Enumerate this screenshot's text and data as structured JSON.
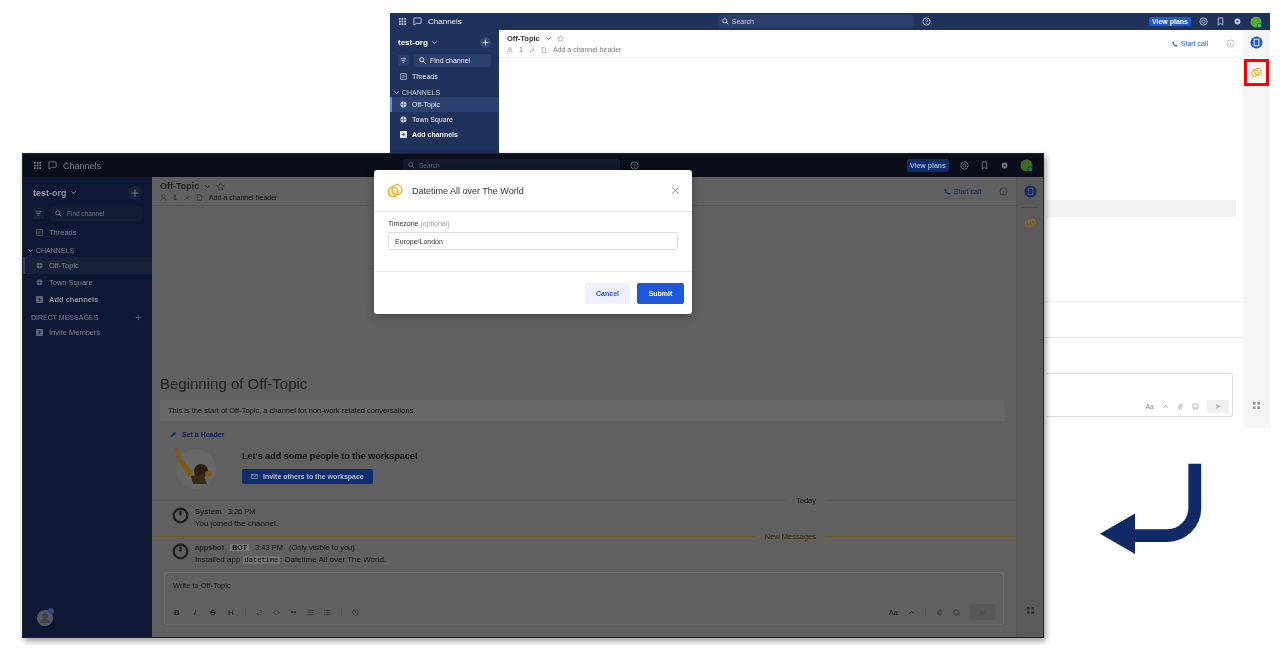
{
  "back_window": {
    "top_bar": {
      "title": "Channels",
      "search_placeholder": "Search",
      "view_plans": "View plans"
    },
    "sidebar": {
      "team": "test-org",
      "find_channel": "Find channel",
      "threads": "Threads",
      "section": "CHANNELS",
      "channels": [
        {
          "name": "Off-Topic",
          "selected": true
        },
        {
          "name": "Town Square",
          "selected": false
        }
      ],
      "add_channels": "Add channels"
    },
    "channel_header": {
      "name": "Off-Topic",
      "member_count": "1",
      "header_placeholder": "Add a channel header",
      "start_call": "Start call"
    },
    "composer": {
      "format_button": "Aa"
    }
  },
  "front_window": {
    "top_bar": {
      "title": "Channels",
      "search_placeholder": "Search",
      "view_plans": "View plans"
    },
    "sidebar": {
      "team": "test-org",
      "find_channel": "Find channel",
      "threads": "Threads",
      "section": "CHANNELS",
      "channels": [
        {
          "name": "Off-Topic",
          "selected": true
        },
        {
          "name": "Town Square",
          "selected": false
        }
      ],
      "add_channels": "Add channels",
      "dm_section": "DIRECT MESSAGES",
      "invite_members": "Invite Members"
    },
    "channel_header": {
      "name": "Off-Topic",
      "member_count": "1",
      "header_placeholder": "Add a channel header",
      "start_call": "Start call"
    },
    "intro": {
      "title": "Beginning of Off-Topic",
      "description": "This is the start of Off-Topic, a channel for non-work-related conversations.",
      "set_header": "Set a Header",
      "invite_prompt": "Let's add some people to the workspace!",
      "invite_button": "Invite others to the workspace"
    },
    "dividers": {
      "today": "Today",
      "new_messages": "New Messages"
    },
    "messages": [
      {
        "author": "System",
        "time": "3:26 PM",
        "text": "You joined the channel."
      },
      {
        "author": "appsbot",
        "badge": "BOT",
        "time": "3:43 PM",
        "note": "(Only visible to you)",
        "text_before": "Installed app",
        "code": "datetime",
        "text_after": ": Datetime All over The World."
      }
    ],
    "composer": {
      "placeholder": "Write to Off-Topic",
      "format_letters": [
        "B",
        "I",
        "S",
        "H"
      ],
      "format_button": "Aa"
    },
    "modal": {
      "title": "Datetime All over The World",
      "field_label": "Timezone",
      "field_hint": "(optional)",
      "field_value": "Europe/London",
      "cancel": "Cancel",
      "submit": "Submit"
    }
  }
}
